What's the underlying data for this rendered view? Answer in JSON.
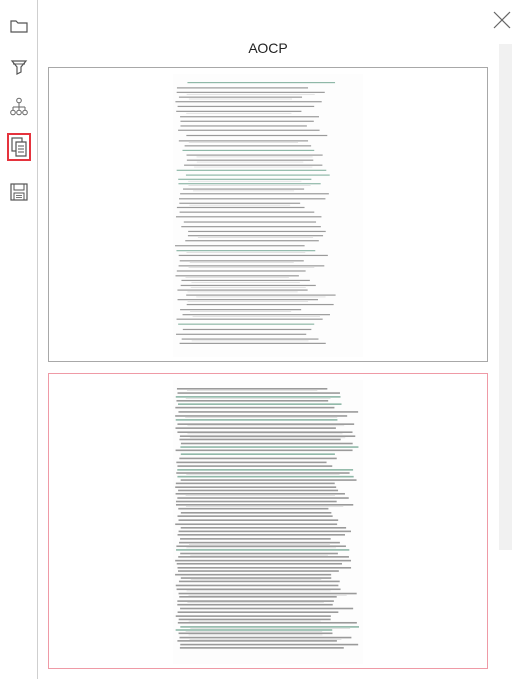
{
  "toolbar": {
    "tools": [
      {
        "name": "folder-icon",
        "active": false
      },
      {
        "name": "filter-icon",
        "active": false
      },
      {
        "name": "hierarchy-icon",
        "active": false
      },
      {
        "name": "documents-icon",
        "active": true
      },
      {
        "name": "save-icon",
        "active": false
      }
    ],
    "active_color": "#e5333d"
  },
  "panel": {
    "title": "АОСР",
    "pages": [
      {
        "selected": false,
        "border_color": "#a8a8a8"
      },
      {
        "selected": true,
        "border_color": "#ef9aa6"
      }
    ]
  }
}
